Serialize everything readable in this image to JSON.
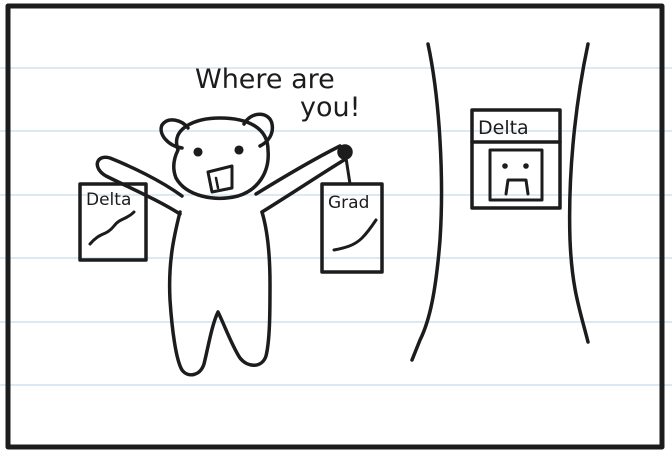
{
  "speech": {
    "line1": "Where are",
    "line2": "you!"
  },
  "left_sign": {
    "label": "Delta"
  },
  "right_sign": {
    "label": "Grad"
  },
  "wall_sign": {
    "label": "Delta"
  },
  "colors": {
    "ink": "#1c1c1c",
    "paper": "#ffffff",
    "rule_line": "#cfe3ee"
  }
}
